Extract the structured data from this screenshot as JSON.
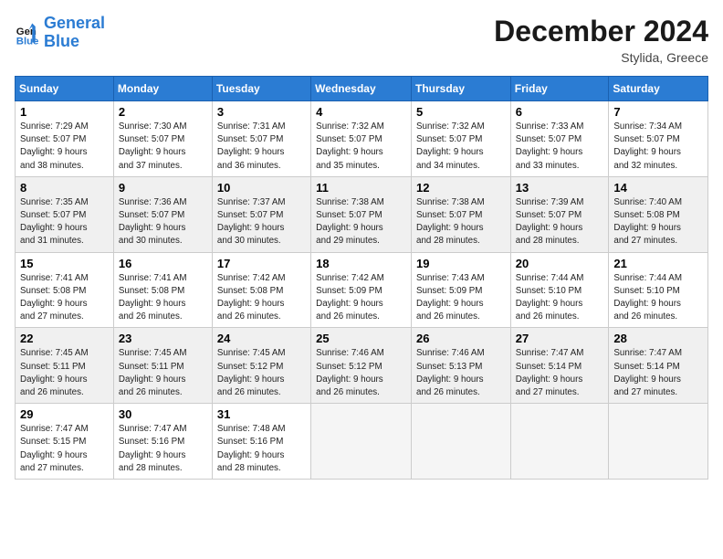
{
  "logo": {
    "line1": "General",
    "line2": "Blue"
  },
  "title": "December 2024",
  "subtitle": "Stylida, Greece",
  "days_header": [
    "Sunday",
    "Monday",
    "Tuesday",
    "Wednesday",
    "Thursday",
    "Friday",
    "Saturday"
  ],
  "weeks": [
    [
      {
        "day": "1",
        "info": "Sunrise: 7:29 AM\nSunset: 5:07 PM\nDaylight: 9 hours\nand 38 minutes."
      },
      {
        "day": "2",
        "info": "Sunrise: 7:30 AM\nSunset: 5:07 PM\nDaylight: 9 hours\nand 37 minutes."
      },
      {
        "day": "3",
        "info": "Sunrise: 7:31 AM\nSunset: 5:07 PM\nDaylight: 9 hours\nand 36 minutes."
      },
      {
        "day": "4",
        "info": "Sunrise: 7:32 AM\nSunset: 5:07 PM\nDaylight: 9 hours\nand 35 minutes."
      },
      {
        "day": "5",
        "info": "Sunrise: 7:32 AM\nSunset: 5:07 PM\nDaylight: 9 hours\nand 34 minutes."
      },
      {
        "day": "6",
        "info": "Sunrise: 7:33 AM\nSunset: 5:07 PM\nDaylight: 9 hours\nand 33 minutes."
      },
      {
        "day": "7",
        "info": "Sunrise: 7:34 AM\nSunset: 5:07 PM\nDaylight: 9 hours\nand 32 minutes."
      }
    ],
    [
      {
        "day": "8",
        "info": "Sunrise: 7:35 AM\nSunset: 5:07 PM\nDaylight: 9 hours\nand 31 minutes."
      },
      {
        "day": "9",
        "info": "Sunrise: 7:36 AM\nSunset: 5:07 PM\nDaylight: 9 hours\nand 30 minutes."
      },
      {
        "day": "10",
        "info": "Sunrise: 7:37 AM\nSunset: 5:07 PM\nDaylight: 9 hours\nand 30 minutes."
      },
      {
        "day": "11",
        "info": "Sunrise: 7:38 AM\nSunset: 5:07 PM\nDaylight: 9 hours\nand 29 minutes."
      },
      {
        "day": "12",
        "info": "Sunrise: 7:38 AM\nSunset: 5:07 PM\nDaylight: 9 hours\nand 28 minutes."
      },
      {
        "day": "13",
        "info": "Sunrise: 7:39 AM\nSunset: 5:07 PM\nDaylight: 9 hours\nand 28 minutes."
      },
      {
        "day": "14",
        "info": "Sunrise: 7:40 AM\nSunset: 5:08 PM\nDaylight: 9 hours\nand 27 minutes."
      }
    ],
    [
      {
        "day": "15",
        "info": "Sunrise: 7:41 AM\nSunset: 5:08 PM\nDaylight: 9 hours\nand 27 minutes."
      },
      {
        "day": "16",
        "info": "Sunrise: 7:41 AM\nSunset: 5:08 PM\nDaylight: 9 hours\nand 26 minutes."
      },
      {
        "day": "17",
        "info": "Sunrise: 7:42 AM\nSunset: 5:08 PM\nDaylight: 9 hours\nand 26 minutes."
      },
      {
        "day": "18",
        "info": "Sunrise: 7:42 AM\nSunset: 5:09 PM\nDaylight: 9 hours\nand 26 minutes."
      },
      {
        "day": "19",
        "info": "Sunrise: 7:43 AM\nSunset: 5:09 PM\nDaylight: 9 hours\nand 26 minutes."
      },
      {
        "day": "20",
        "info": "Sunrise: 7:44 AM\nSunset: 5:10 PM\nDaylight: 9 hours\nand 26 minutes."
      },
      {
        "day": "21",
        "info": "Sunrise: 7:44 AM\nSunset: 5:10 PM\nDaylight: 9 hours\nand 26 minutes."
      }
    ],
    [
      {
        "day": "22",
        "info": "Sunrise: 7:45 AM\nSunset: 5:11 PM\nDaylight: 9 hours\nand 26 minutes."
      },
      {
        "day": "23",
        "info": "Sunrise: 7:45 AM\nSunset: 5:11 PM\nDaylight: 9 hours\nand 26 minutes."
      },
      {
        "day": "24",
        "info": "Sunrise: 7:45 AM\nSunset: 5:12 PM\nDaylight: 9 hours\nand 26 minutes."
      },
      {
        "day": "25",
        "info": "Sunrise: 7:46 AM\nSunset: 5:12 PM\nDaylight: 9 hours\nand 26 minutes."
      },
      {
        "day": "26",
        "info": "Sunrise: 7:46 AM\nSunset: 5:13 PM\nDaylight: 9 hours\nand 26 minutes."
      },
      {
        "day": "27",
        "info": "Sunrise: 7:47 AM\nSunset: 5:14 PM\nDaylight: 9 hours\nand 27 minutes."
      },
      {
        "day": "28",
        "info": "Sunrise: 7:47 AM\nSunset: 5:14 PM\nDaylight: 9 hours\nand 27 minutes."
      }
    ],
    [
      {
        "day": "29",
        "info": "Sunrise: 7:47 AM\nSunset: 5:15 PM\nDaylight: 9 hours\nand 27 minutes."
      },
      {
        "day": "30",
        "info": "Sunrise: 7:47 AM\nSunset: 5:16 PM\nDaylight: 9 hours\nand 28 minutes."
      },
      {
        "day": "31",
        "info": "Sunrise: 7:48 AM\nSunset: 5:16 PM\nDaylight: 9 hours\nand 28 minutes."
      },
      null,
      null,
      null,
      null
    ]
  ]
}
